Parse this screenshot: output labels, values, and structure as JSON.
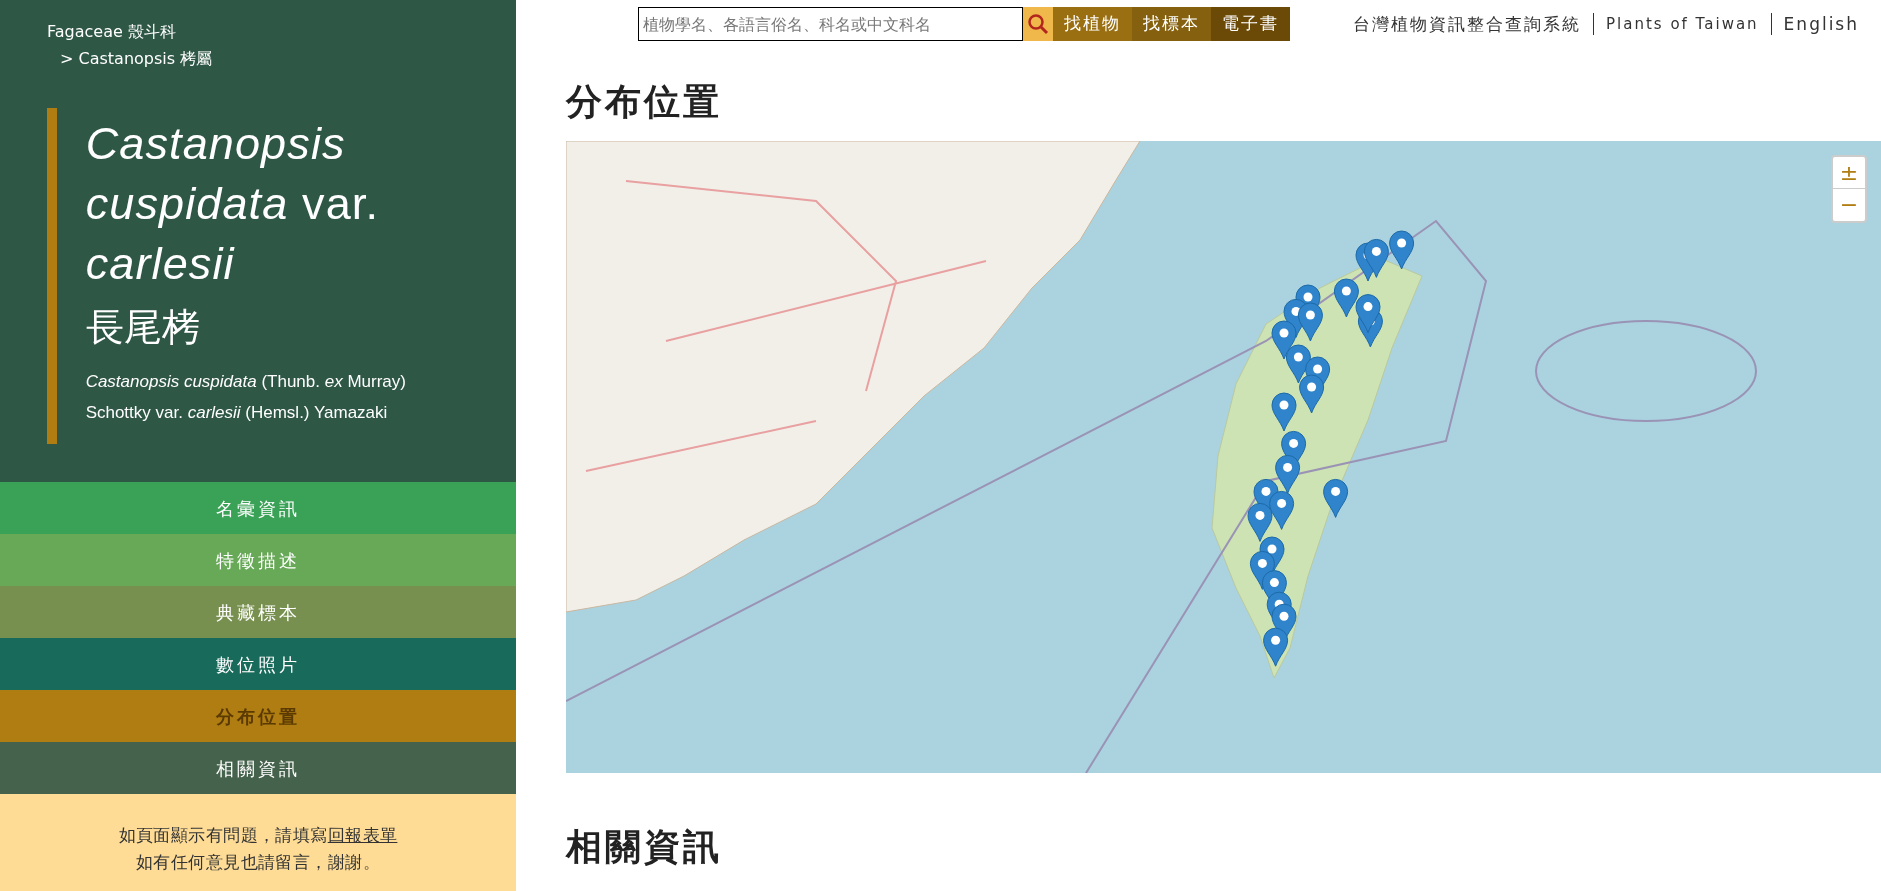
{
  "sidebar": {
    "breadcrumb": [
      "Fagaceae 殼斗科",
      "> Castanopsis 栲屬"
    ],
    "title": "*Castanopsis cuspidata* var. *carlesii*",
    "chinese_name": "長尾栲",
    "authority": "*Castanopsis cuspidata* (Thunb. *ex* Murray) Schottky var. *carlesii* (Hemsl.) Yamazaki",
    "nav": [
      {
        "label": "名彙資訊",
        "color": "#3aa257",
        "selected": false
      },
      {
        "label": "特徵描述",
        "color": "#67a957",
        "selected": false
      },
      {
        "label": "典藏標本",
        "color": "#78904f",
        "selected": false
      },
      {
        "label": "數位照片",
        "color": "#186a5a",
        "selected": false
      },
      {
        "label": "分布位置",
        "color": "#b07d12",
        "selected": true
      },
      {
        "label": "相關資訊",
        "color": "#45634c",
        "selected": false
      }
    ],
    "feedback": {
      "text": "如頁面顯示有問題，請填寫",
      "link": "回報表單",
      "line2": "如有任何意見也請留言，謝謝。"
    }
  },
  "header": {
    "search": {
      "placeholder": "植物學名、各語言俗名、科名或中文科名"
    },
    "buttons": [
      {
        "label": "找植物",
        "color": "#9a6f12"
      },
      {
        "label": "找標本",
        "color": "#85600f"
      },
      {
        "label": "電子書",
        "color": "#6b4a08"
      }
    ],
    "links": [
      "台灣植物資訊整合查詢系統",
      "Plants of Taiwan",
      "English"
    ]
  },
  "section": {
    "title": "分布位置",
    "map": {
      "zoom_in": "±",
      "zoom_out": "−"
    }
  },
  "next_section": {
    "title": "相關資訊"
  }
}
